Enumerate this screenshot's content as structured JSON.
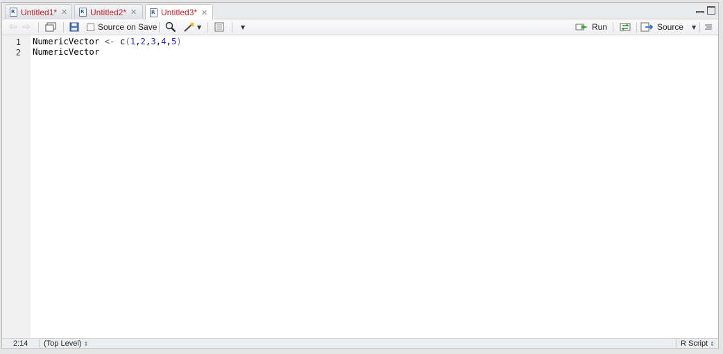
{
  "tabs": [
    {
      "label": "Untitled1*",
      "active": false
    },
    {
      "label": "Untitled2*",
      "active": false
    },
    {
      "label": "Untitled3*",
      "active": true
    }
  ],
  "toolbar": {
    "source_on_save_label": "Source on Save",
    "run_label": "Run",
    "source_label": "Source"
  },
  "editor": {
    "line_numbers": [
      "1",
      "2"
    ],
    "line1": {
      "identifier": "NumericVector",
      "assign": "<-",
      "func": "c",
      "open": "(",
      "n1": "1",
      "n2": "2",
      "n3": "3",
      "n4": "4",
      "n5": "5",
      "close": ")"
    },
    "line2": "NumericVector"
  },
  "status": {
    "position": "2:14",
    "scope": "(Top Level)",
    "file_type": "R Script"
  }
}
